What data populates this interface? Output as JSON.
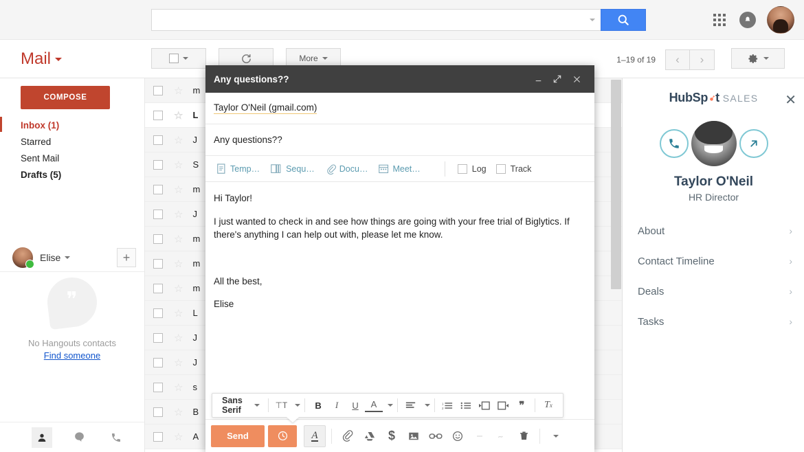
{
  "topbar": {
    "search_value": "",
    "search_placeholder": "",
    "search_icon": "search-icon",
    "apps_icon": "apps-grid-icon",
    "notifications_icon": "bell-icon",
    "account_avatar": "user-avatar"
  },
  "mailbar": {
    "logo": "Mail",
    "select_all_label": "",
    "refresh_label": "",
    "more_label": "More",
    "pager_count": "1–19 of 19",
    "prev_label": "‹",
    "next_label": "›",
    "settings_icon": "gear-icon"
  },
  "sidebar": {
    "compose_label": "COMPOSE",
    "items": [
      {
        "label": "Inbox (1)",
        "state": "active"
      },
      {
        "label": "Starred",
        "state": "normal"
      },
      {
        "label": "Sent Mail",
        "state": "normal"
      },
      {
        "label": "Drafts (5)",
        "state": "bold"
      }
    ]
  },
  "hangouts": {
    "user_name": "Elise",
    "add_label": "+",
    "empty_title": "No Hangouts contacts",
    "find_link": "Find someone",
    "tabs": [
      "contacts-icon",
      "chat-icon",
      "phone-icon"
    ]
  },
  "maillist": {
    "rows": [
      {
        "sender": "m",
        "read": true
      },
      {
        "sender": "L",
        "read": false
      },
      {
        "sender": "J",
        "read": true
      },
      {
        "sender": "S",
        "read": true
      },
      {
        "sender": "m",
        "read": true
      },
      {
        "sender": "J",
        "read": true
      },
      {
        "sender": "m",
        "read": true
      },
      {
        "sender": "m",
        "read": true
      },
      {
        "sender": "m",
        "read": true
      },
      {
        "sender": "L",
        "read": true
      },
      {
        "sender": "J",
        "read": true
      },
      {
        "sender": "J",
        "read": true
      },
      {
        "sender": "s",
        "read": true
      },
      {
        "sender": "B",
        "read": true
      },
      {
        "sender": "A",
        "read": true
      }
    ]
  },
  "hubspot": {
    "brand_hub": "Hub",
    "brand_spot": "Sp",
    "brand_spot_tail": "t",
    "brand_sales": "SALES",
    "close_label": "✕",
    "call_icon": "phone-icon",
    "open_icon": "external-link-icon",
    "contact_name": "Taylor O'Neil",
    "contact_title": "HR Director",
    "links": [
      {
        "label": "About",
        "chevron": "›"
      },
      {
        "label": "Contact Timeline",
        "chevron": "›"
      },
      {
        "label": "Deals",
        "chevron": "›"
      },
      {
        "label": "Tasks",
        "chevron": "›"
      }
    ]
  },
  "compose": {
    "title": "Any questions??",
    "minimize_label": "—",
    "expand_label": "⤢",
    "close_label": "✕",
    "to": "Taylor O'Neil (gmail.com)",
    "subject": "Any questions??",
    "hubspot_tools": [
      {
        "label": "Temp…",
        "icon": "template-icon"
      },
      {
        "label": "Sequ…",
        "icon": "sequence-icon"
      },
      {
        "label": "Docu…",
        "icon": "document-icon"
      },
      {
        "label": "Meet…",
        "icon": "meeting-calendar-icon"
      }
    ],
    "log_label": "Log",
    "track_label": "Track",
    "body": [
      "Hi Taylor!",
      "I just wanted to check in and see how things are going with your free trial of Biglytics. If there's anything I can help out with, please let me know.",
      "",
      "All the best,",
      "Elise"
    ],
    "format_toolbar": {
      "font_name": "Sans Serif",
      "font_caret": "▾",
      "buttons": [
        {
          "label": "⊤T",
          "name": "font-size-icon"
        },
        {
          "label": "B",
          "name": "bold-icon"
        },
        {
          "label": "I",
          "name": "italic-icon"
        },
        {
          "label": "U",
          "name": "underline-icon"
        },
        {
          "label": "A",
          "name": "text-color-icon"
        },
        {
          "label": "≡",
          "name": "align-icon"
        },
        {
          "label": "1≡",
          "name": "numbered-list-icon"
        },
        {
          "label": "•≡",
          "name": "bulleted-list-icon"
        },
        {
          "label": "⇤",
          "name": "indent-less-icon"
        },
        {
          "label": "⇥",
          "name": "indent-more-icon"
        },
        {
          "label": "❞",
          "name": "quote-icon"
        },
        {
          "label": "Tx",
          "name": "remove-formatting-icon"
        }
      ]
    },
    "actions": {
      "send_label": "Send",
      "schedule_icon": "clock-icon",
      "format_icon": "format-text-icon",
      "attach_icon": "paperclip-icon",
      "drive_icon": "google-drive-icon",
      "money_icon": "dollar-icon",
      "photo_icon": "insert-photo-icon",
      "link_icon": "insert-link-icon",
      "emoji_icon": "emoji-icon",
      "faint1_icon": "confidential-mode-icon",
      "faint2_icon": "signature-icon",
      "trash_icon": "trash-icon",
      "more_icon": "more-options-icon"
    }
  }
}
